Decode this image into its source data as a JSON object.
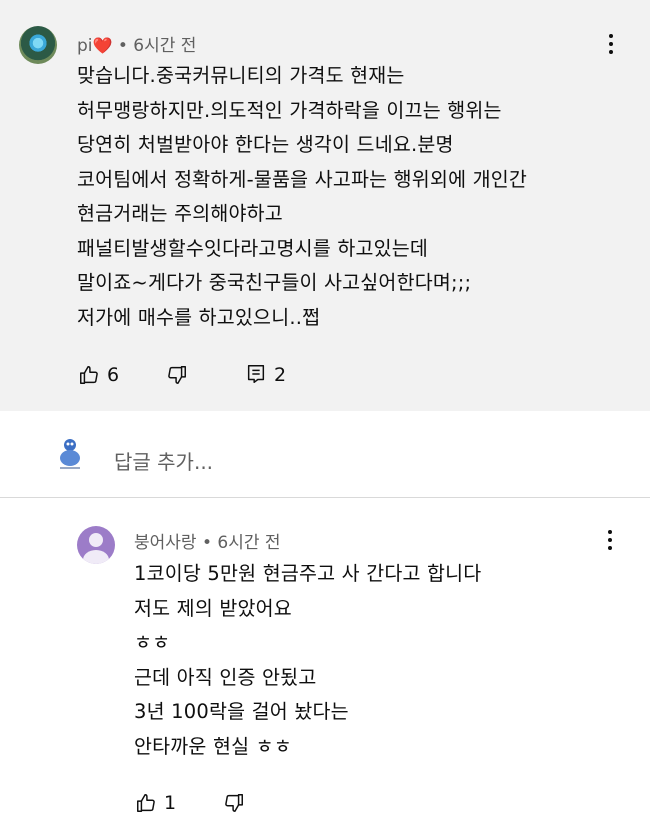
{
  "top_comment": {
    "author": "pi",
    "time": "• 6시간 전",
    "lines": [
      "맞습니다.중국커뮤니티의 가격도 현재는",
      "허무맹랑하지만.의도적인 가격하락을 이끄는 행위는",
      "당연히 처벌받아야 한다는  생각이 드네요.분명",
      "코어팀에서 정확하게-물품을 사고파는 행위외에 개인간",
      "현금거래는 주의해야하고",
      "패널티발생할수잇다라고명시를 하고있는데",
      "말이죠~게다가 중국친구들이 사고싶어한다며;;;",
      "저가에 매수를 하고있으니..쩝"
    ],
    "likes": "6",
    "replies": "2",
    "icons": {
      "avatar": "avatar-image",
      "like": "thumbs-up-icon",
      "dislike": "thumbs-down-icon",
      "reply": "reply-comment-icon",
      "menu": "more-vert-icon",
      "heart": "heart-emoji"
    }
  },
  "reply_box": {
    "placeholder": "답글 추가..."
  },
  "reply": {
    "author": "붕어사랑",
    "time": "• 6시간 전",
    "lines": [
      "1코이당 5만원 현금주고 사 간다고 합니다",
      "저도 제의 받았어요",
      "ㅎㅎ",
      "근데 아직 인증 안됬고",
      "3년 100락을  걸어 놨다는",
      "안타까운 현실 ㅎㅎ"
    ],
    "likes": "1"
  },
  "colors": {
    "highlight_bg": "#f2f2f2",
    "secondary_text": "#606060",
    "heart": "#e0245e",
    "default_avatar": "#9c7cc8"
  }
}
